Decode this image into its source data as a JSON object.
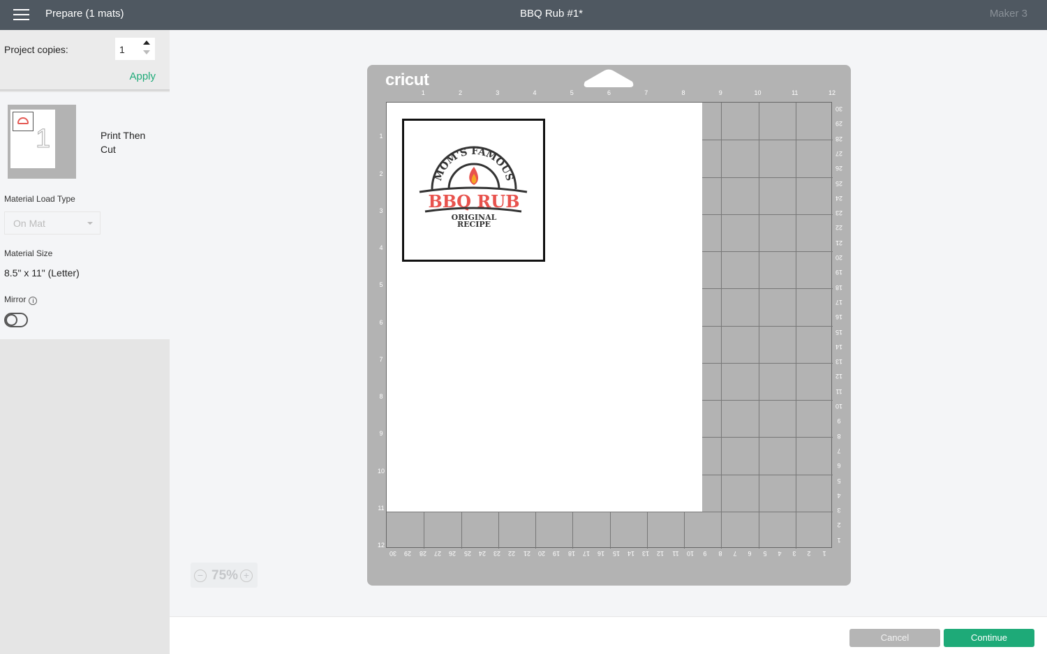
{
  "header": {
    "menu_icon": "hamburger-icon",
    "prepare_title": "Prepare (1 mats)",
    "project_title": "BBQ Rub #1*",
    "machine": "Maker 3"
  },
  "sidebar": {
    "copies_label": "Project copies:",
    "copies_value": "1",
    "apply_label": "Apply",
    "mat_number": "1",
    "mat_mode": "Print Then Cut",
    "load_type_label": "Material Load Type",
    "load_type_value": "On Mat",
    "size_label": "Material Size",
    "size_value": "8.5\" x 11\" (Letter)",
    "mirror_label": "Mirror",
    "mirror_on": false
  },
  "mat": {
    "brand": "cricut",
    "top_ruler": [
      "1",
      "2",
      "3",
      "4",
      "5",
      "6",
      "7",
      "8",
      "9",
      "10",
      "11",
      "12"
    ],
    "left_ruler": [
      "1",
      "2",
      "3",
      "4",
      "5",
      "6",
      "7",
      "8",
      "9",
      "10",
      "11",
      "12"
    ],
    "right_ruler": [
      "30",
      "29",
      "28",
      "27",
      "26",
      "25",
      "24",
      "23",
      "22",
      "21",
      "20",
      "19",
      "18",
      "17",
      "16",
      "15",
      "14",
      "13",
      "12",
      "11",
      "10",
      "9",
      "8",
      "7",
      "6",
      "5",
      "4",
      "3",
      "2",
      "1"
    ],
    "bottom_ruler": [
      "30",
      "29",
      "28",
      "27",
      "26",
      "25",
      "24",
      "23",
      "22",
      "21",
      "20",
      "19",
      "18",
      "17",
      "16",
      "15",
      "14",
      "13",
      "12",
      "11",
      "10",
      "9",
      "8",
      "7",
      "6",
      "5",
      "4",
      "3",
      "2",
      "1"
    ],
    "design": {
      "arc_text": "MOM'S FAMOUS",
      "main_text": "BBQ RUB",
      "line1": "ORIGINAL",
      "line2": "RECIPE",
      "accent": "#e8524d",
      "flame": "#f5a623"
    }
  },
  "zoom": {
    "value": "75%"
  },
  "footer": {
    "cancel": "Cancel",
    "continue": "Continue"
  },
  "colors": {
    "header": "#4f5861",
    "accent": "#1eaa78",
    "mat": "#b3b3b3"
  }
}
